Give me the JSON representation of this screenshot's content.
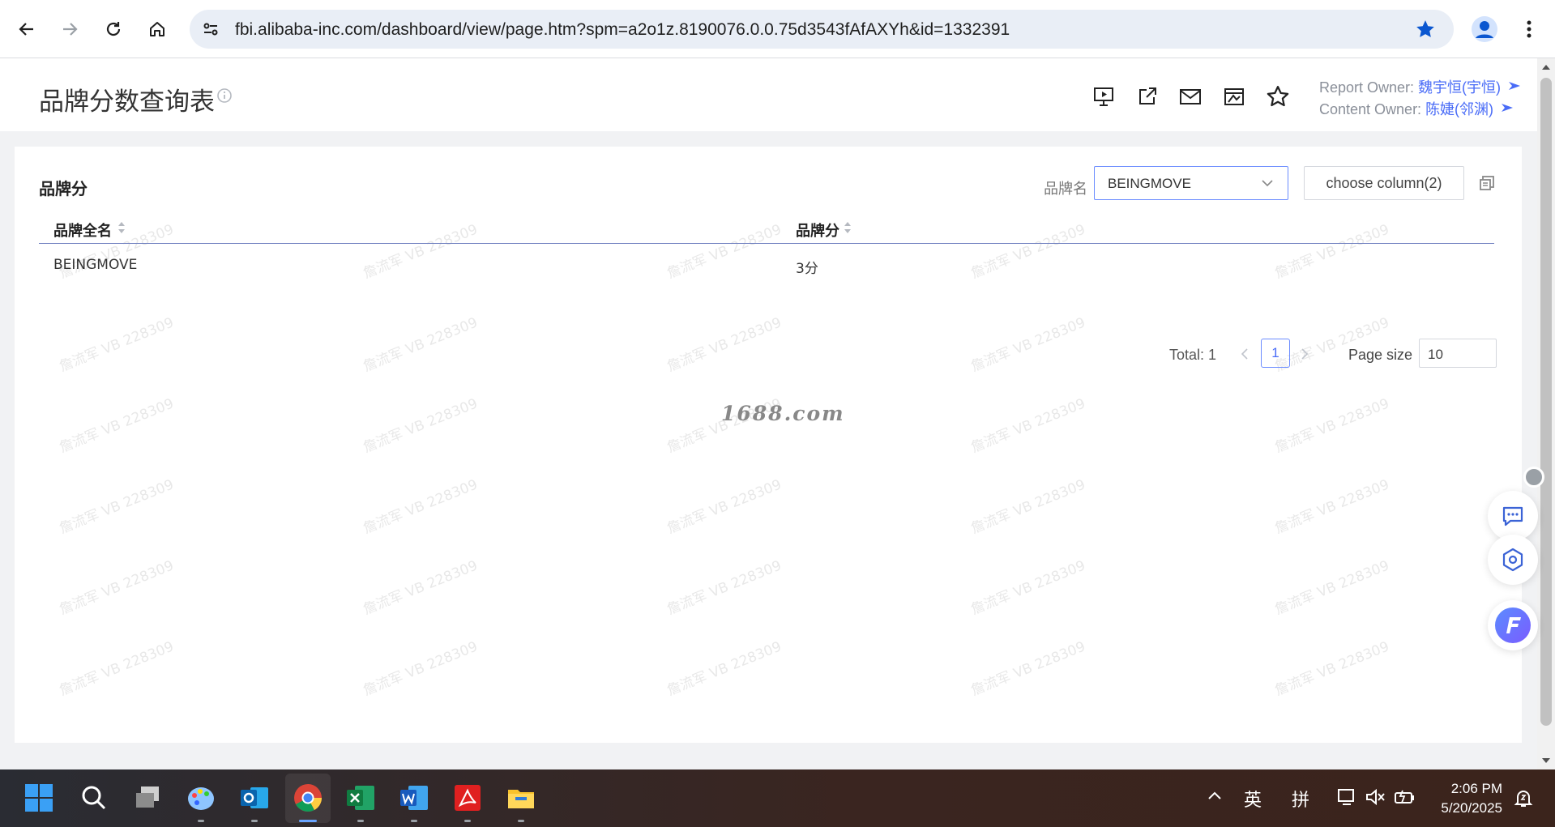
{
  "browser": {
    "url": "fbi.alibaba-inc.com/dashboard/view/page.htm?spm=a2o1z.8190076.0.0.75d3543fAfAXYh&id=1332391"
  },
  "header": {
    "title": "品牌分数查询表",
    "report_owner_label": "Report Owner: ",
    "report_owner_name": "魏宇恒(宇恒)",
    "content_owner_label": "Content Owner: ",
    "content_owner_name": "陈婕(邻渊)"
  },
  "card": {
    "title": "品牌分",
    "filter_label": "品牌名",
    "filter_value": "BEINGMOVE",
    "choose_column_label": "choose column(2)",
    "table": {
      "columns": [
        "品牌全名",
        "品牌分"
      ],
      "rows": [
        [
          "BEINGMOVE",
          "3分"
        ]
      ]
    },
    "pagination": {
      "total_label": "Total: 1",
      "current_page": "1",
      "page_size_label": "Page size",
      "page_size_value": "10"
    }
  },
  "watermark": {
    "text": "詹流军 VB 228309",
    "center_text": "1688.com"
  },
  "taskbar": {
    "ime_lang": "英",
    "ime_mode": "拼",
    "time": "2:06 PM",
    "date": "5/20/2025"
  },
  "colors": {
    "accent": "#4a6cf7",
    "chrome_bg": "#ffffff",
    "omnibox_bg": "#e9eef6",
    "page_bg": "#f1f2f4"
  }
}
